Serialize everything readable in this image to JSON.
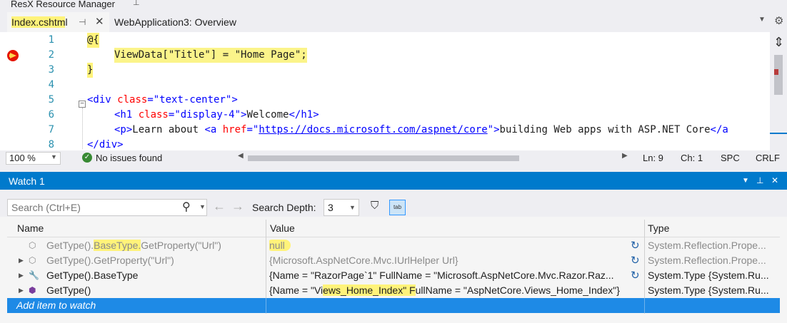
{
  "header": {
    "title": "ResX Resource Manager"
  },
  "tabs": [
    {
      "label_hl": "Index.cshtm",
      "label_rest": "l"
    },
    {
      "label": "WebApplication3: Overview"
    }
  ],
  "editor": {
    "lines": [
      {
        "num": "1",
        "text": "@{"
      },
      {
        "num": "2",
        "text": "ViewData[\"Title\"] = \"Home Page\";"
      },
      {
        "num": "3",
        "text": "}"
      },
      {
        "num": "4",
        "text": ""
      },
      {
        "num": "5",
        "tag_open": "<div ",
        "attr": "class",
        "eq": "=",
        "val": "\"text-center\"",
        "close": ">"
      },
      {
        "num": "6",
        "tag_open": "<h1 ",
        "attr": "class",
        "eq": "=",
        "val": "\"display-4\"",
        "close": ">",
        "content": "Welcome",
        "end_tag": "</h1>"
      },
      {
        "num": "7",
        "p_open": "<p>",
        "p_text1": "Learn about ",
        "a_open": "<a ",
        "a_attr": "href",
        "a_eq": "=",
        "a_q1": "\"",
        "a_link": "https://docs.microsoft.com/aspnet/core",
        "a_q2": "\"",
        "a_close": ">",
        "a_text": "building Web apps with ASP.NET Core",
        "a_tail": "</a"
      },
      {
        "num": "8",
        "text": "</div>"
      }
    ]
  },
  "status": {
    "zoom": "100 %",
    "issues": "No issues found",
    "ln": "Ln: 9",
    "ch": "Ch: 1",
    "spc": "SPC",
    "crlf": "CRLF"
  },
  "watch": {
    "title": "Watch 1",
    "search_placeholder": "Search (Ctrl+E)",
    "depth_label": "Search Depth:",
    "depth_value": "3",
    "columns": {
      "name": "Name",
      "value": "Value",
      "type": "Type"
    },
    "rows": [
      {
        "name_a": "GetType().",
        "name_hl": "BaseType.",
        "name_b": "GetProperty(\"Url\")",
        "value": "null",
        "type": "System.Reflection.Prope..."
      },
      {
        "name": "GetType().GetProperty(\"Url\")",
        "value": "{Microsoft.AspNetCore.Mvc.IUrlHelper Url}",
        "type": "System.Reflection.Prope..."
      },
      {
        "name": "GetType().BaseType",
        "value": "{Name = \"RazorPage`1\" FullName = \"Microsoft.AspNetCore.Mvc.Razor.Raz...",
        "type": "System.Type {System.Ru..."
      },
      {
        "name": "GetType()",
        "value_a": "{Name = \"Vi",
        "value_hl": "ews_Home_Index\" F",
        "value_b": "ullName = \"AspNetCore.Views_Home_Index\"}",
        "type": "System.Type {System.Ru..."
      }
    ],
    "add_item": "Add item to watch"
  }
}
